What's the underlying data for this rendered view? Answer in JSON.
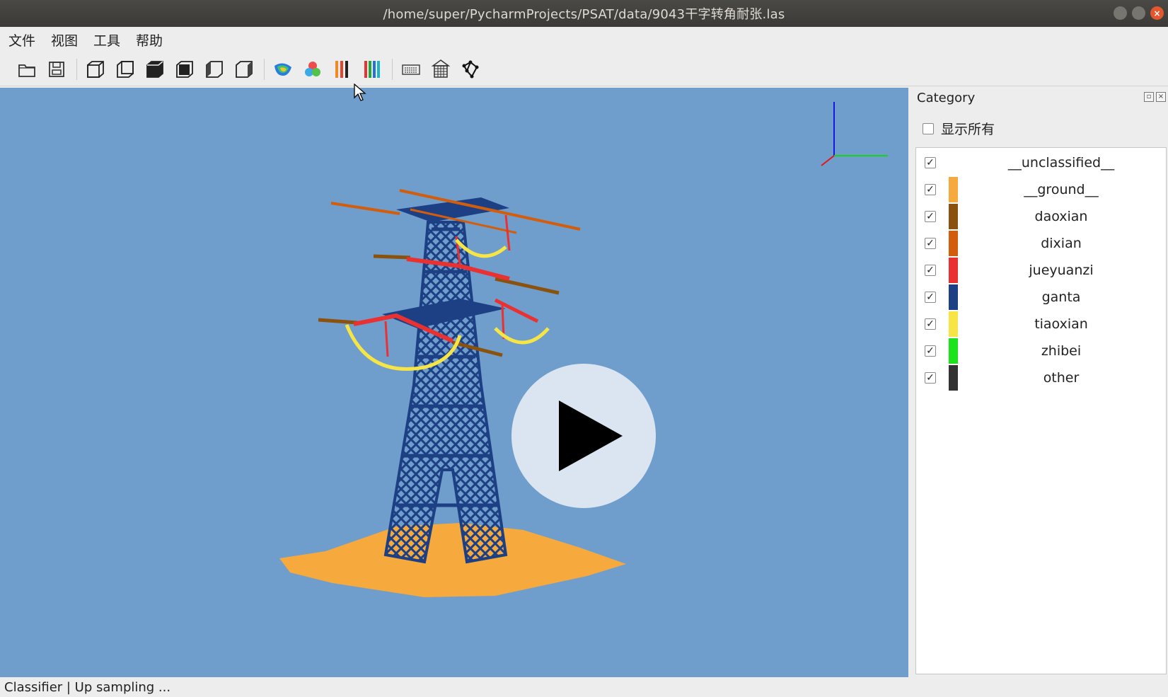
{
  "window": {
    "title": "/home/super/PycharmProjects/PSAT/data/9043干字转角耐张.las"
  },
  "menu": [
    "文件",
    "视图",
    "工具",
    "帮助"
  ],
  "toolbar": {
    "buttons": [
      {
        "name": "open-folder-icon"
      },
      {
        "name": "save-icon"
      },
      {
        "name": "view-front-icon"
      },
      {
        "name": "view-back-icon"
      },
      {
        "name": "view-top-icon"
      },
      {
        "name": "view-bottom-icon"
      },
      {
        "name": "view-left-icon"
      },
      {
        "name": "view-right-icon"
      },
      {
        "name": "elevation-color-icon"
      },
      {
        "name": "rgb-color-icon"
      },
      {
        "name": "classification-color-icon"
      },
      {
        "name": "multi-color-icon"
      },
      {
        "name": "keyboard-icon"
      },
      {
        "name": "building-icon"
      },
      {
        "name": "graph-network-icon"
      }
    ]
  },
  "dock": {
    "title": "Category",
    "show_all_label": "显示所有",
    "show_all_checked": false,
    "categories": [
      {
        "name": "__unclassified__",
        "checked": true,
        "color": null
      },
      {
        "name": "__ground__",
        "checked": true,
        "color": "#f6a93c"
      },
      {
        "name": "daoxian",
        "checked": true,
        "color": "#8a520c"
      },
      {
        "name": "dixian",
        "checked": true,
        "color": "#d25d0c"
      },
      {
        "name": "jueyuanzi",
        "checked": true,
        "color": "#ea3131"
      },
      {
        "name": "ganta",
        "checked": true,
        "color": "#1d3f84"
      },
      {
        "name": "tiaoxian",
        "checked": true,
        "color": "#f7e545"
      },
      {
        "name": "zhibei",
        "checked": true,
        "color": "#1de31d"
      },
      {
        "name": "other",
        "checked": true,
        "color": "#333333"
      }
    ]
  },
  "status": {
    "text": "Classifier | Up sampling ..."
  },
  "colors": {
    "viewport_bg": "#6f9ecd",
    "ground": "#f6a93c",
    "tower": "#1d3f84"
  }
}
